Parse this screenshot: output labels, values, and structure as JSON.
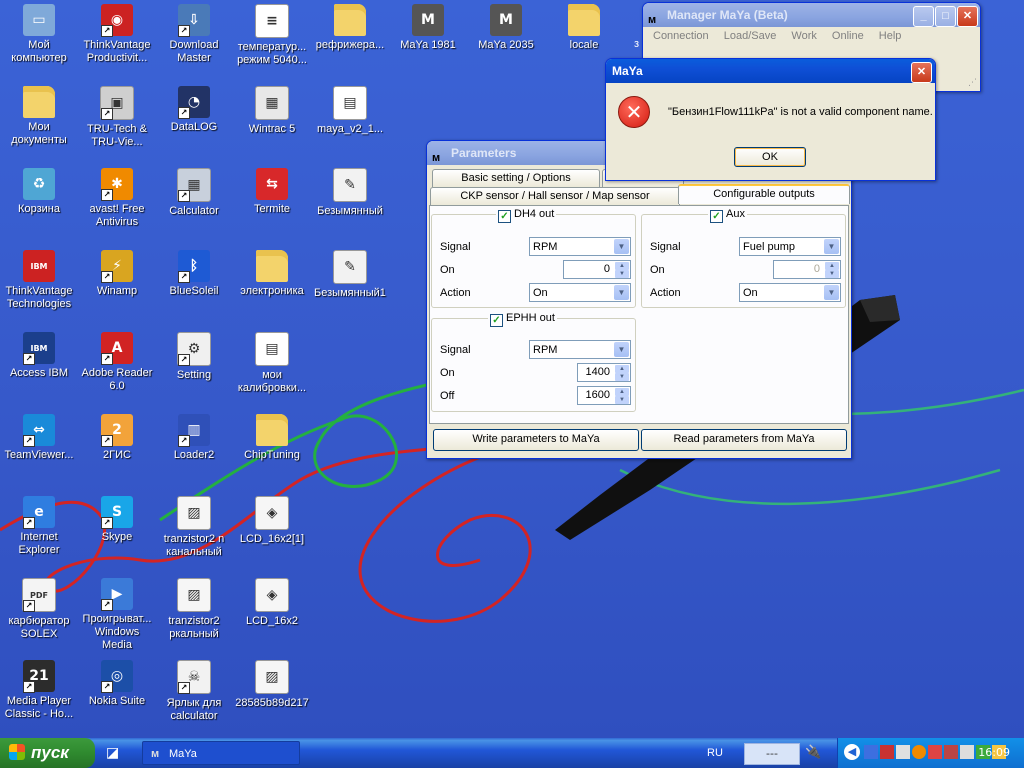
{
  "desktop": {
    "icons": [
      {
        "label": "Мой компьютер",
        "icon": "my-computer-icon",
        "color": "#7fa9d9",
        "glyph": "▭",
        "shortcut": false
      },
      {
        "label": "ThinkVantage Productivit...",
        "icon": "thinkvantage-icon",
        "color": "#cc2222",
        "glyph": "◉",
        "shortcut": true
      },
      {
        "label": "Download Master",
        "icon": "download-master-icon",
        "color": "#4a7ab8",
        "glyph": "⇩",
        "shortcut": true
      },
      {
        "label": "температур... режим 5040...",
        "icon": "document-icon",
        "color": "#ffffff",
        "glyph": "≡",
        "shortcut": false
      },
      {
        "label": "рефрижера...",
        "icon": "folder-icon",
        "color": "#f3d36b",
        "glyph": "",
        "shortcut": false
      },
      {
        "label": "MaYa 1981",
        "icon": "maya-icon",
        "color": "#555555",
        "glyph": "M",
        "shortcut": false
      },
      {
        "label": "MaYa 2035",
        "icon": "maya-icon",
        "color": "#555555",
        "glyph": "M",
        "shortcut": false
      },
      {
        "label": "locale",
        "icon": "folder-icon",
        "color": "#f3d36b",
        "glyph": "",
        "shortcut": false
      },
      {
        "label": "Мои документы",
        "icon": "my-documents-icon",
        "color": "#f3d36b",
        "glyph": "",
        "shortcut": false
      },
      {
        "label": "TRU-Tech & TRU-Vie...",
        "icon": "tru-tech-icon",
        "color": "#cfcfcf",
        "glyph": "▣",
        "shortcut": true
      },
      {
        "label": "DataLOG",
        "icon": "datalog-icon",
        "color": "#223366",
        "glyph": "◔",
        "shortcut": true
      },
      {
        "label": "Wintrac 5",
        "icon": "wintrac-icon",
        "color": "#e8e8e8",
        "glyph": "▦",
        "shortcut": false
      },
      {
        "label": "maya_v2_1...",
        "icon": "archive-icon",
        "color": "#ffffff",
        "glyph": "▤",
        "shortcut": false
      },
      {
        "label": "Корзина",
        "icon": "recycle-bin-icon",
        "color": "#4fa6d4",
        "glyph": "♻",
        "shortcut": false
      },
      {
        "label": "avast! Free Antivirus",
        "icon": "avast-icon",
        "color": "#f08a00",
        "glyph": "✱",
        "shortcut": true
      },
      {
        "label": "Calculator",
        "icon": "calculator-icon",
        "color": "#c8d0dc",
        "glyph": "▦",
        "shortcut": true
      },
      {
        "label": "Termite",
        "icon": "termite-icon",
        "color": "#d8282a",
        "glyph": "⇆",
        "shortcut": false
      },
      {
        "label": "Безымянный",
        "icon": "paint-icon",
        "color": "#f2f2f2",
        "glyph": "✎",
        "shortcut": false
      },
      {
        "label": "ThinkVantage Technologies",
        "icon": "ibm-icon",
        "color": "#cc2222",
        "glyph": "IBM",
        "shortcut": false
      },
      {
        "label": "Winamp",
        "icon": "winamp-icon",
        "color": "#d9a520",
        "glyph": "⚡",
        "shortcut": true
      },
      {
        "label": "BlueSoleil",
        "icon": "bluetooth-icon",
        "color": "#1e5ad4",
        "glyph": "ᛒ",
        "shortcut": true
      },
      {
        "label": "электроника",
        "icon": "folder-icon",
        "color": "#f3d36b",
        "glyph": "",
        "shortcut": false
      },
      {
        "label": "Безымянный1",
        "icon": "paint-icon",
        "color": "#f2f2f2",
        "glyph": "✎",
        "shortcut": false
      },
      {
        "label": "Access IBM",
        "icon": "access-ibm-icon",
        "color": "#1b3f8c",
        "glyph": "IBM",
        "shortcut": true
      },
      {
        "label": "Adobe Reader 6.0",
        "icon": "adobe-reader-icon",
        "color": "#d12323",
        "glyph": "A",
        "shortcut": true
      },
      {
        "label": "Setting",
        "icon": "setting-icon",
        "color": "#f0f0f0",
        "glyph": "⚙",
        "shortcut": true
      },
      {
        "label": "мои калибровки...",
        "icon": "archive-icon",
        "color": "#ffffff",
        "glyph": "▤",
        "shortcut": false
      },
      {
        "label": "TeamViewer...",
        "icon": "teamviewer-icon",
        "color": "#1a8ad9",
        "glyph": "⇔",
        "shortcut": true
      },
      {
        "label": "2ГИС",
        "icon": "2gis-icon",
        "color": "#f2a33a",
        "glyph": "2",
        "shortcut": true
      },
      {
        "label": "Loader2",
        "icon": "loader-icon",
        "color": "#2f50b8",
        "glyph": "▥",
        "shortcut": true
      },
      {
        "label": "ChipTuning",
        "icon": "folder-icon",
        "color": "#f3d36b",
        "glyph": "",
        "shortcut": false
      },
      {
        "label": "Internet Explorer",
        "icon": "internet-explorer-icon",
        "color": "#2f7de0",
        "glyph": "e",
        "shortcut": true
      },
      {
        "label": "Skype",
        "icon": "skype-icon",
        "color": "#19a6e8",
        "glyph": "S",
        "shortcut": true
      },
      {
        "label": "tranzistor2 n канальный",
        "icon": "image-file-icon",
        "color": "#f6f6f6",
        "glyph": "▨",
        "shortcut": false
      },
      {
        "label": "LCD_16x2[1]",
        "icon": "image-file-icon",
        "color": "#f6f6f6",
        "glyph": "◈",
        "shortcut": false
      },
      {
        "label": "карбюратор SOLEX",
        "icon": "pdf-icon",
        "color": "#f4f4f4",
        "glyph": "PDF",
        "shortcut": true
      },
      {
        "label": "Проигрыват... Windows Media",
        "icon": "windows-media-player-icon",
        "color": "#3b7ad8",
        "glyph": "▶",
        "shortcut": true
      },
      {
        "label": "tranzistor2 ркальный",
        "icon": "image-file-icon",
        "color": "#f6f6f6",
        "glyph": "▨",
        "shortcut": false
      },
      {
        "label": "LCD_16x2",
        "icon": "image-file-icon",
        "color": "#f6f6f6",
        "glyph": "◈",
        "shortcut": false
      },
      {
        "label": "Media Player Classic - Ho...",
        "icon": "media-player-classic-icon",
        "color": "#2c2c2c",
        "glyph": "21",
        "shortcut": true
      },
      {
        "label": "Nokia Suite",
        "icon": "nokia-suite-icon",
        "color": "#1c4fa8",
        "glyph": "◎",
        "shortcut": true
      },
      {
        "label": "Ярлык для calculator",
        "icon": "skull-icon",
        "color": "#f2f2f2",
        "glyph": "☠",
        "shortcut": true
      },
      {
        "label": "28585b89d217",
        "icon": "image-file-icon",
        "color": "#f6f6f6",
        "glyph": "▨",
        "shortcut": false
      }
    ],
    "partial_label": "з"
  },
  "manager_window": {
    "title": "Manager MaYa (Beta)",
    "menu": [
      "Connection",
      "Load/Save",
      "Work",
      "Online",
      "Help"
    ]
  },
  "error_dialog": {
    "title": "MaYa",
    "message": "\"Бензин1Flow111kPa\" is not a valid component name.",
    "ok_label": "OK"
  },
  "parameters_window": {
    "title": "Parameters",
    "tabs_row1": [
      "Basic setting / Options"
    ],
    "tabs_row2": [
      "CKP sensor / Hall sensor / Map sensor",
      "Configurable outputs"
    ],
    "active_tab": "Configurable outputs",
    "dh4": {
      "title": "DH4 out",
      "checked": true,
      "signal_label": "Signal",
      "signal_value": "RPM",
      "on_label": "On",
      "on_value": "0",
      "action_label": "Action",
      "action_value": "On"
    },
    "aux": {
      "title": "Aux",
      "checked": true,
      "signal_label": "Signal",
      "signal_value": "Fuel pump",
      "on_label": "On",
      "on_value": "0",
      "action_label": "Action",
      "action_value": "On"
    },
    "ephh": {
      "title": "EPHH out",
      "checked": true,
      "signal_label": "Signal",
      "signal_value": "RPM",
      "on_label": "On",
      "on_value": "1400",
      "off_label": "Off",
      "off_value": "1600"
    },
    "write_button": "Write parameters to MaYa",
    "read_button": "Read parameters from MaYa"
  },
  "taskbar": {
    "start_label": "пуск",
    "task_label": "MaYa",
    "language": "RU",
    "tray_box": "---",
    "clock": "16:09"
  }
}
